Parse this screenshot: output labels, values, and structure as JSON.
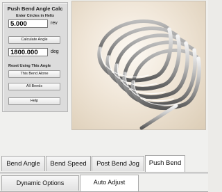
{
  "calc_panel": {
    "title": "Push Bend Angle Calc",
    "circles_label": "Enter Circles in Helix",
    "circles_value": "5.000",
    "circles_unit": "rev",
    "calculate_label": "Calculate Angle",
    "angle_value": "1800.000",
    "angle_unit": "deg",
    "reset_label": "Reset  Using This Angle",
    "this_bend_alone_label": "This Bend Alone",
    "all_bends_label": "All Bends",
    "help_label": "Help"
  },
  "viewport": {
    "image_icon": "helix-spring-render"
  },
  "tabs_row1": [
    {
      "label": "Bend Angle",
      "active": false
    },
    {
      "label": "Bend Speed",
      "active": false
    },
    {
      "label": "Post Bend Jog",
      "active": false
    },
    {
      "label": "Push Bend",
      "active": true
    }
  ],
  "tabs_row2": [
    {
      "label": "Dynamic Options",
      "active": false
    },
    {
      "label": "Auto Adjust",
      "active": true
    }
  ]
}
